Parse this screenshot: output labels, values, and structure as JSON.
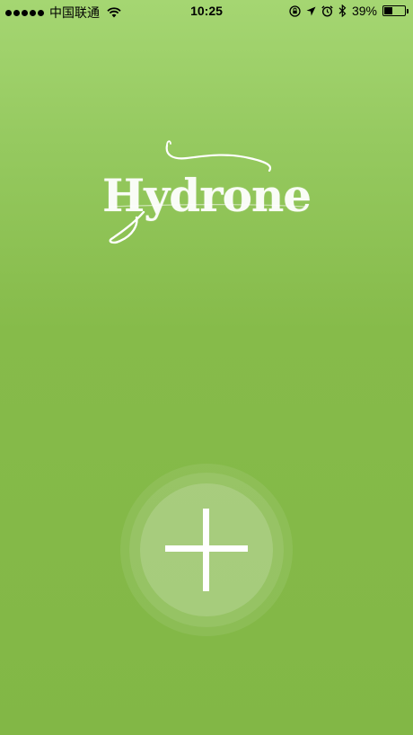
{
  "status_bar": {
    "carrier": "中国联通",
    "time": "10:25",
    "battery_percent": "39%",
    "battery_level": 0.39,
    "icons": [
      "signal-dots-icon",
      "wifi-icon",
      "orientation-lock-icon",
      "location-arrow-icon",
      "alarm-icon",
      "bluetooth-icon",
      "battery-icon"
    ]
  },
  "logo": {
    "text": "Hydrone"
  },
  "main": {
    "add_button_icon": "plus-icon"
  },
  "colors": {
    "background_top": "#a5d672",
    "background_bottom": "#82b746",
    "foreground": "#ffffff"
  }
}
